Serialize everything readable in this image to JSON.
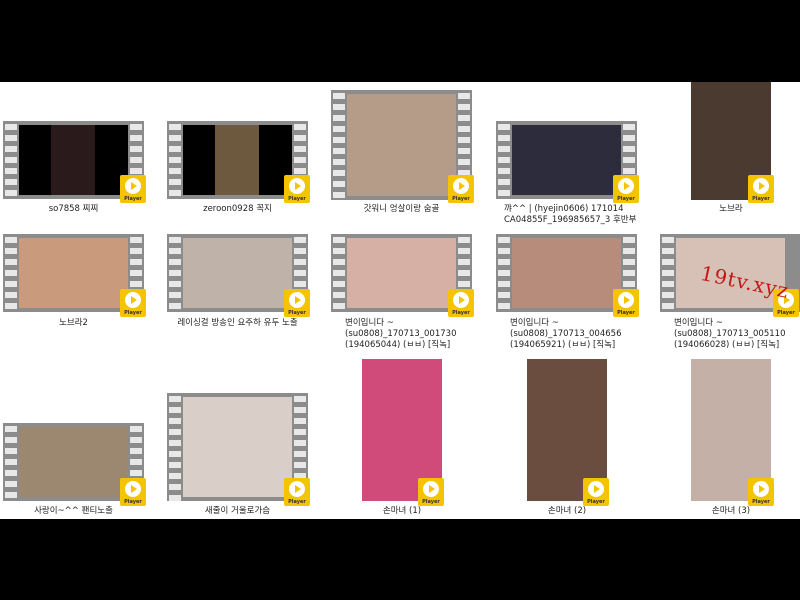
{
  "items": [
    {
      "label": "so7858 찌찌",
      "player_label": "Player",
      "frame_color": "#2b1a1c"
    },
    {
      "label": "zeroon0928 꼭지",
      "player_label": "Player",
      "frame_color": "#6d5a3e"
    },
    {
      "label": "갓워니 엉살이랑 숨골",
      "player_label": "Player",
      "frame_color": "#b49c88"
    },
    {
      "label": "꺄^^ | (hyejin0606) 171014 CA04855F_196985657_3 후반부",
      "player_label": "Player",
      "frame_color": "#2c2c3c"
    },
    {
      "label": "노브라",
      "player_label": "Player",
      "frame_color": "#4a3a30"
    },
    {
      "label": "노브라2",
      "player_label": "Player",
      "frame_color": "#c99a7c"
    },
    {
      "label": "레이싱걸 방송인 요주하 유두 노출",
      "player_label": "Player",
      "frame_color": "#bfb3a9"
    },
    {
      "label": "변이입니다 ~(su0808)_170713_001730 (194065044) (ㅂㅂ) [직녹]",
      "player_label": "Player",
      "frame_color": "#d6b0a4"
    },
    {
      "label": "변이입니다 ~(su0808)_170713_004656 (194065921) (ㅂㅂ) [직녹]",
      "player_label": "Player",
      "frame_color": "#b88c7a"
    },
    {
      "label": "변이입니다 ~(su0808)_170713_005110 (194066028) (ㅂㅂ) [직녹]",
      "player_label": "Player",
      "frame_color": "#d7c0b5"
    },
    {
      "label": "사랑이~^^ 팬티노출",
      "player_label": "Player",
      "frame_color": "#9c8870"
    },
    {
      "label": "새줄이 거울로가슴",
      "player_label": "Player",
      "frame_color": "#d9cfc8"
    },
    {
      "label": "손마녀 (1)",
      "player_label": "Player",
      "frame_color": "#d14b7a"
    },
    {
      "label": "손마녀 (2)",
      "player_label": "Player",
      "frame_color": "#6b4d3f"
    },
    {
      "label": "손마녀 (3)",
      "player_label": "Player",
      "frame_color": "#c4b0a6"
    }
  ],
  "watermark": "19tv.xyz",
  "colors": {
    "player_badge": "#f5c400",
    "film_strip": "#8c8c8c",
    "background": "#ffffff",
    "letterbox": "#000000"
  }
}
